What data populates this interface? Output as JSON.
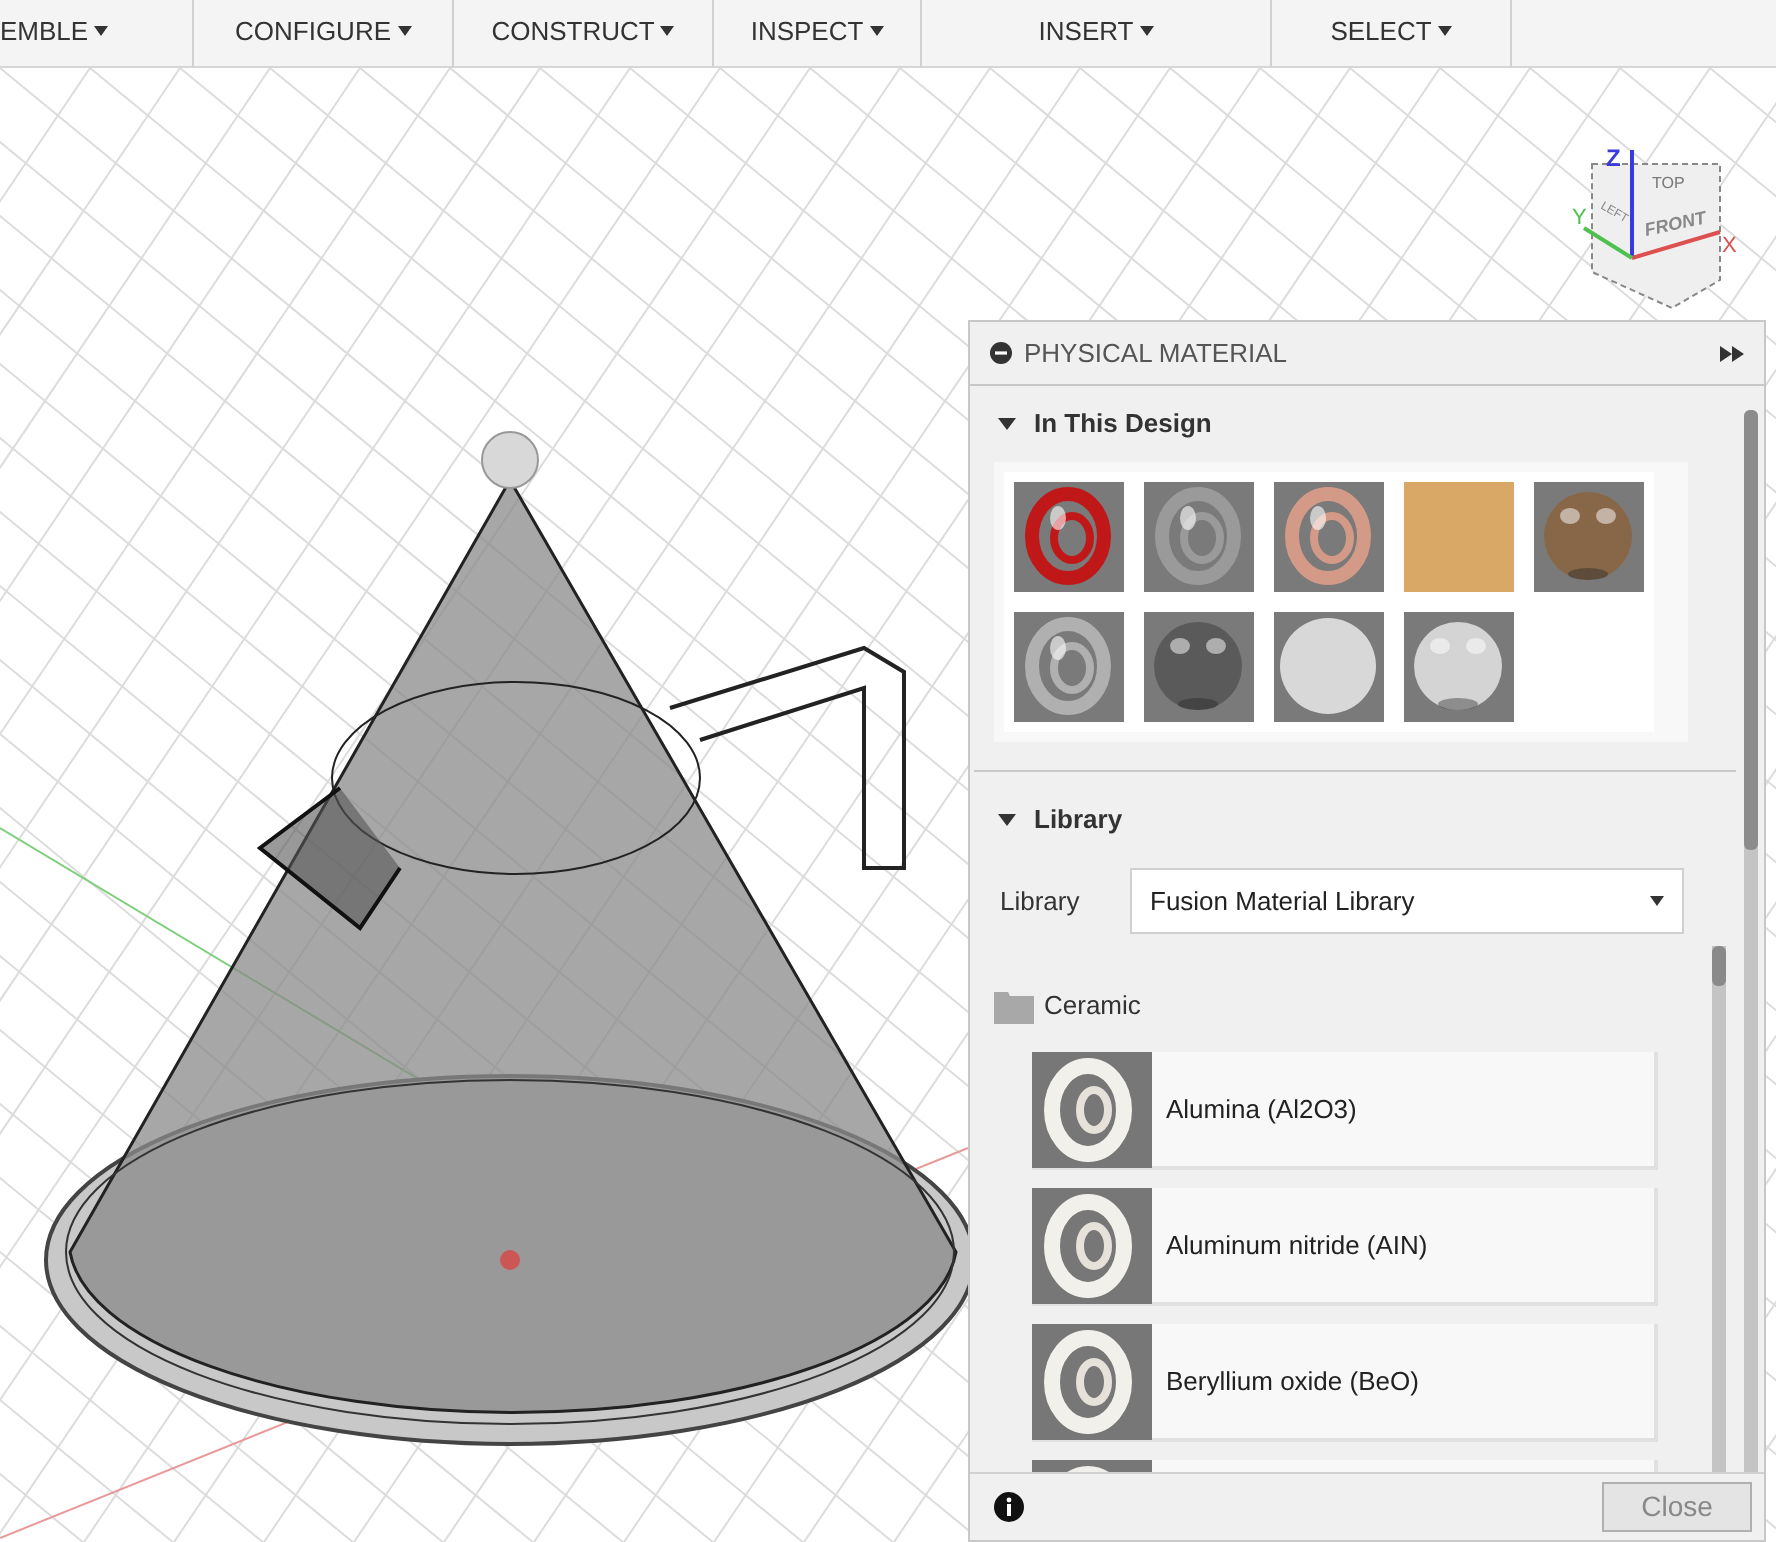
{
  "toolbar": {
    "groups": [
      {
        "label": "EMBLE"
      },
      {
        "label": "CONFIGURE"
      },
      {
        "label": "CONSTRUCT"
      },
      {
        "label": "INSPECT"
      },
      {
        "label": "INSERT"
      },
      {
        "label": "SELECT"
      }
    ]
  },
  "view_cube": {
    "face_front": "FRONT",
    "face_top": "TOP",
    "face_left": "LEFT",
    "axis_z": "Z",
    "axis_y": "Y",
    "axis_x": "X"
  },
  "panel": {
    "title": "PHYSICAL MATERIAL",
    "in_design": {
      "title": "In This Design",
      "expanded": true,
      "swatches": [
        {
          "kind": "ring",
          "color": "#c01818"
        },
        {
          "kind": "ring",
          "color": "#9a9a9a"
        },
        {
          "kind": "ring",
          "color": "#d49a88"
        },
        {
          "kind": "cube",
          "color": "#d9a866"
        },
        {
          "kind": "globe",
          "color": "#8a6440"
        },
        {
          "kind": "ring",
          "color": "#b0b0b0"
        },
        {
          "kind": "globe",
          "color": "#555555"
        },
        {
          "kind": "sphere",
          "color": "#d8d8d8"
        },
        {
          "kind": "globe",
          "color": "#e4e4e4"
        }
      ]
    },
    "library": {
      "title": "Library",
      "expanded": true,
      "field_label": "Library",
      "value": "Fusion Material Library",
      "folder": "Ceramic",
      "materials": [
        {
          "name": "Alumina (Al2O3)"
        },
        {
          "name": "Aluminum nitride (AIN)"
        },
        {
          "name": "Beryllium oxide (BeO)"
        }
      ],
      "more_below": true
    },
    "close_button": "Close"
  }
}
